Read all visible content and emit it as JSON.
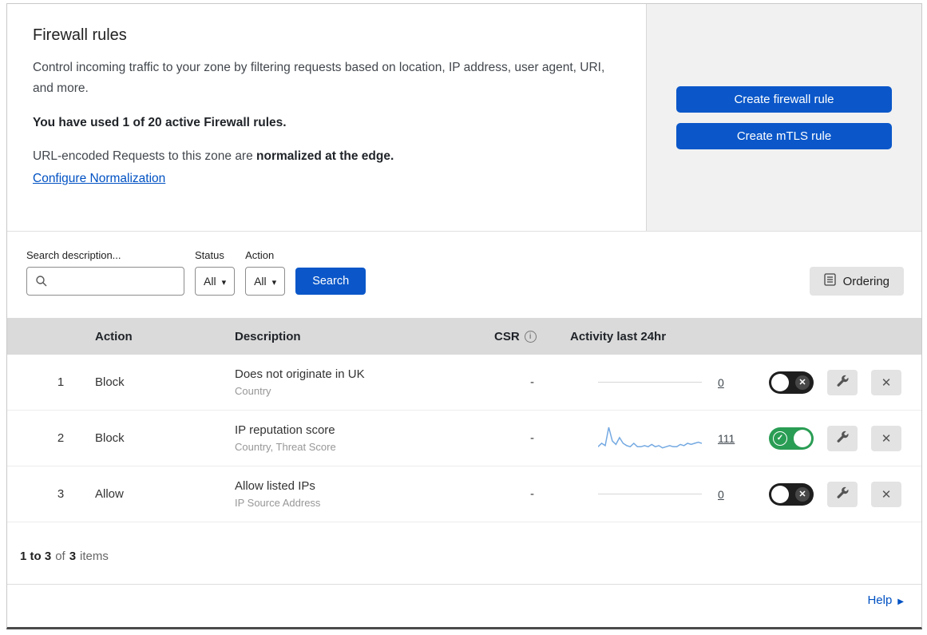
{
  "intro": {
    "title": "Firewall rules",
    "description": "Control incoming traffic to your zone by filtering requests based on location, IP address, user agent, URI, and more.",
    "usage": "You have used 1 of 20 active Firewall rules.",
    "normalization_text": "URL-encoded Requests to this zone are",
    "normalization_bold": "normalized at the edge.",
    "normalization_link": "Configure Normalization",
    "buttons": {
      "create_firewall": "Create firewall rule",
      "create_mtls": "Create mTLS rule"
    }
  },
  "filters": {
    "search_label": "Search description...",
    "status_label": "Status",
    "status_value": "All",
    "action_label": "Action",
    "action_value": "All",
    "search_button": "Search",
    "ordering_button": "Ordering"
  },
  "table": {
    "headers": {
      "action": "Action",
      "description": "Description",
      "csr": "CSR",
      "activity": "Activity last 24hr"
    },
    "rows": [
      {
        "index": "1",
        "action": "Block",
        "description": "Does not originate in UK",
        "criteria": "Country",
        "csr": "-",
        "activity_count": "0",
        "enabled": false,
        "sparkline": []
      },
      {
        "index": "2",
        "action": "Block",
        "description": "IP reputation score",
        "criteria": "Country, Threat Score",
        "csr": "-",
        "activity_count": "111",
        "enabled": true,
        "sparkline": [
          4,
          7,
          5,
          21,
          9,
          6,
          12,
          7,
          5,
          4,
          7,
          4,
          4,
          5,
          4,
          6,
          4,
          5,
          3,
          4,
          5,
          4,
          4,
          6,
          5,
          7,
          6,
          7,
          8,
          7
        ]
      },
      {
        "index": "3",
        "action": "Allow",
        "description": "Allow listed IPs",
        "criteria": "IP Source Address",
        "csr": "-",
        "activity_count": "0",
        "enabled": false,
        "sparkline": []
      }
    ]
  },
  "footer": {
    "range": "1 to 3",
    "of_text": "of",
    "total": "3",
    "items_text": "items"
  },
  "help": {
    "label": "Help"
  },
  "colors": {
    "accent_blue": "#0b57c9",
    "link_blue": "#0051c3",
    "toggle_green": "#2a9d54",
    "sparkline_blue": "#74a9e2"
  },
  "chart_data": {
    "type": "line",
    "title": "Activity last 24hr (rule 2 sparkline)",
    "x": "last 24 hours",
    "values": [
      4,
      7,
      5,
      21,
      9,
      6,
      12,
      7,
      5,
      4,
      7,
      4,
      4,
      5,
      4,
      6,
      4,
      5,
      3,
      4,
      5,
      4,
      4,
      6,
      5,
      7,
      6,
      7,
      8,
      7
    ],
    "total": 111
  }
}
